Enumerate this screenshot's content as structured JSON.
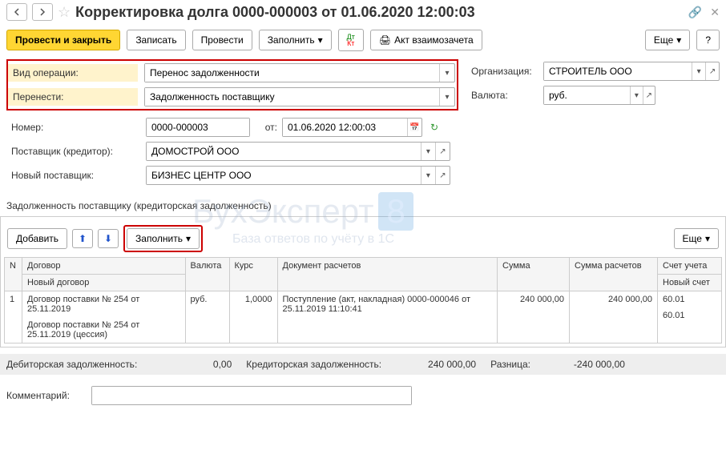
{
  "title": "Корректировка долга 0000-000003 от 01.06.2020 12:00:03",
  "toolbar": {
    "post_close": "Провести и закрыть",
    "save": "Записать",
    "post": "Провести",
    "fill": "Заполнить",
    "act": "Акт взаимозачета",
    "more": "Еще",
    "help": "?"
  },
  "fields": {
    "op_type_label": "Вид операции:",
    "op_type_value": "Перенос задолженности",
    "transfer_label": "Перенести:",
    "transfer_value": "Задолженность поставщику",
    "org_label": "Организация:",
    "org_value": "СТРОИТЕЛЬ ООО",
    "currency_label": "Валюта:",
    "currency_value": "руб.",
    "number_label": "Номер:",
    "number_value": "0000-000003",
    "from_label": "от:",
    "date_value": "01.06.2020 12:00:03",
    "supplier_label": "Поставщик (кредитор):",
    "supplier_value": "ДОМОСТРОЙ ООО",
    "new_supplier_label": "Новый поставщик:",
    "new_supplier_value": "БИЗНЕС ЦЕНТР ООО"
  },
  "tab_title": "Задолженность поставщику (кредиторская задолженность)",
  "table_toolbar": {
    "add": "Добавить",
    "fill": "Заполнить",
    "more": "Еще"
  },
  "columns": {
    "n": "N",
    "contract": "Договор",
    "new_contract": "Новый договор",
    "currency": "Валюта",
    "rate": "Курс",
    "doc": "Документ расчетов",
    "sum": "Сумма",
    "sum_calc": "Сумма расчетов",
    "account": "Счет учета",
    "new_account": "Новый счет"
  },
  "rows": [
    {
      "n": "1",
      "contract": "Договор поставки № 254 от 25.11.2019",
      "new_contract": "Договор поставки № 254 от 25.11.2019 (цессия)",
      "currency": "руб.",
      "rate": "1,0000",
      "doc": "Поступление (акт, накладная) 0000-000046 от 25.11.2019 11:10:41",
      "sum": "240 000,00",
      "sum_calc": "240 000,00",
      "account": "60.01",
      "new_account": "60.01"
    }
  ],
  "summary": {
    "debit_label": "Дебиторская задолженность:",
    "debit_value": "0,00",
    "credit_label": "Кредиторская задолженность:",
    "credit_value": "240 000,00",
    "diff_label": "Разница:",
    "diff_value": "-240 000,00"
  },
  "comment_label": "Комментарий:",
  "watermark": {
    "main": "БухЭксперт",
    "badge": "8",
    "sub": "База ответов по учёту в 1С"
  }
}
